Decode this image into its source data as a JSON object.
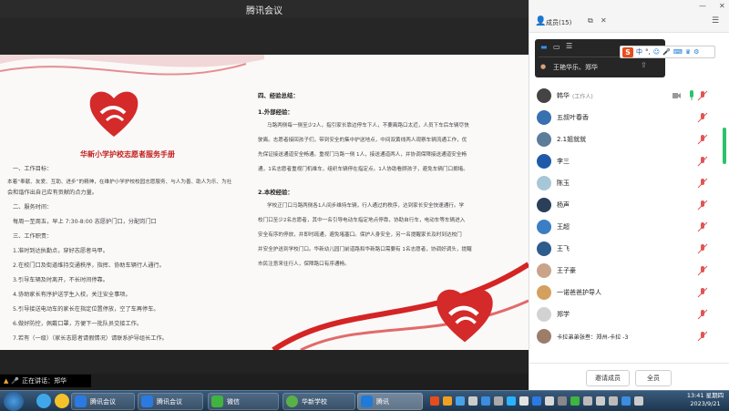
{
  "window": {
    "title": "腾讯会议"
  },
  "document": {
    "title": "华新小学护校志愿者服务手册",
    "left_lines": [
      "一、工作目标：",
      "本着“奉献、友爱、互助、进步”的精神，在维护小学护校校园志愿服务、与人为善、助人为乐、为社",
      "会和谐作出自己应有贡献的点力量。",
      "二、服务时间：",
      "每周一至周五，早上 7:30-8:00  志愿护门口，分配岗门口",
      "三、工作职责：",
      "1.准时到达执勤点，穿好志愿者马甲。",
      "2.在校门口及街道维持交通秩序，指挥、协助车辆行人通行。",
      "3.引导车辆及时离开，不长时间停靠。",
      "4.协助家长有序护送学生入校，关注安全事项。",
      "5.引导接送电动车的家长在指定位置停放，空了车再停车。",
      "6.做好防控，佩戴口罩，方便下一批队员交接工作。",
      "7.若有（一级）（家长志愿者请假情况）请联系护导组长工作。"
    ],
    "right_heading": "四、经验总结：",
    "right_sub1": "1.外部经验：",
    "right_lines1": [
      "马路两侧每一侧至少2人，指引家长靠边停车下人，不要离路口太近，人员下车后车辆尽快",
      "驶离。志愿者接回孩子们，带到安全的集中护送地点，中间双黄线两人观察车辆流通工作，优",
      "先保证接送通道安全畅通。重视门马路一侧 1人，接送通道两人，并协调保障接送通道安全畅",
      "通，1名志愿者重视门机维车，组织车辆停在指定点。1人协助看顾孩子，避免车辆门口拥堵。"
    ],
    "right_sub2": "2.本校经验：",
    "right_lines2": [
      "学校正门口马路两侧各1人间步维持车辆，行人通过的秩序，达到家长安全快速通行。学",
      "校门口至少2名志愿者，其中一名引导电动车指定地点停靠，协助自行车，电动车等车辆进入",
      "安全有序的停放，并即时疏通，避免堵塞口。保护人身安全，另一名提醒家长及时到达校门",
      "并安全护送到学校门口。华新幼儿园门前道路和华新路口需要有 1名志愿者，协调好调头，提醒",
      "市民注意来往行人，保障路口有序通畅。"
    ]
  },
  "panel": {
    "title": "成员(15)",
    "popup_member": "王艳华乐、郑华",
    "ime_label": "中",
    "members": [
      {
        "name": "韩华",
        "sub": "(工作人)",
        "color": "#444444"
      },
      {
        "name": "五叔叶春香",
        "sub": "",
        "color": "#3a6fb0"
      },
      {
        "name": "2.1姐就就",
        "sub": "",
        "color": "#5d7c9a"
      },
      {
        "name": "李三",
        "sub": "",
        "color": "#1f5aa8"
      },
      {
        "name": "陈玉",
        "sub": "",
        "color": "#a6c7d8"
      },
      {
        "name": "杨声",
        "sub": "",
        "color": "#2b3f5a"
      },
      {
        "name": "王超",
        "sub": "",
        "color": "#3b7ec4"
      },
      {
        "name": "王飞",
        "sub": "",
        "color": "#2e5c8c"
      },
      {
        "name": "王子豪",
        "sub": "",
        "color": "#c9a38a"
      },
      {
        "name": "一诺爸爸护导人",
        "sub": "",
        "color": "#d3a05f"
      },
      {
        "name": "郑学",
        "sub": "",
        "color": "#d2d2d2"
      },
      {
        "name": "卡拉弟弟张叁：郑州-卡拉 -3",
        "sub": "",
        "color": "#9b7d6a"
      }
    ],
    "invite_button": "邀请成员",
    "mute_button": "全员"
  },
  "speaker": {
    "label": "正在讲话：郑华"
  },
  "taskbar": {
    "tasks": [
      {
        "label": "腾讯会议",
        "color": "#2a7ae2"
      },
      {
        "label": "腾讯会议",
        "color": "#2a7ae2"
      },
      {
        "label": "微信",
        "color": "#3fb43f"
      },
      {
        "label": "华新学校",
        "color": "#59b247"
      },
      {
        "label": "腾讯",
        "color": "#1f7ad9"
      }
    ],
    "time": "13:41 星期四",
    "date": "2023/9/21"
  },
  "colors": {
    "accent": "#c0201e",
    "green": "#2ac36b"
  }
}
